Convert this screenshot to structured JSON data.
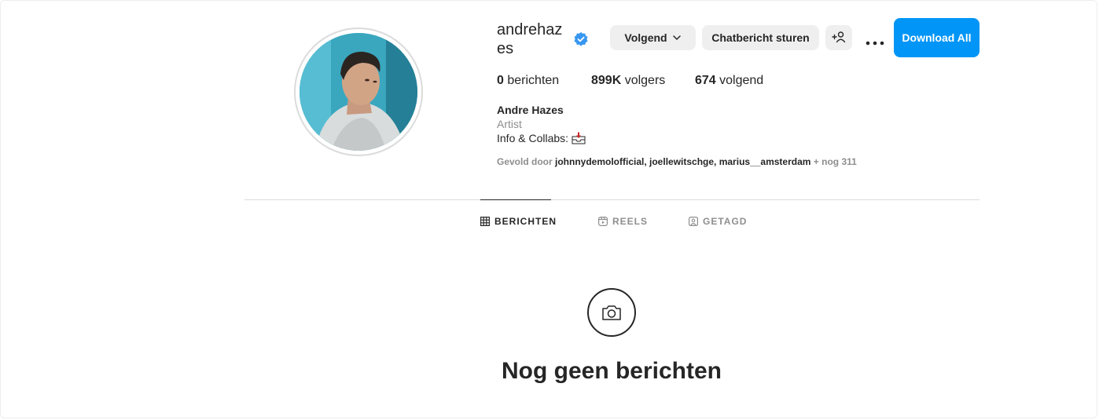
{
  "profile": {
    "username": "andrehazes",
    "verified_icon": "verified-badge-icon",
    "display_name": "Andre Hazes",
    "category": "Artist",
    "bio_line": "Info & Collabs:",
    "bio_emoji_icon": "inbox-tray-icon"
  },
  "actions": {
    "follow_label": "Volgend",
    "message_label": "Chatbericht sturen",
    "add_user_icon": "add-person-icon",
    "more_icon": "more-options-icon",
    "download_label": "Download All",
    "download_color": "#0095f6"
  },
  "stats": {
    "posts_count": "0",
    "posts_label": "berichten",
    "followers_count": "899K",
    "followers_label": "volgers",
    "following_count": "674",
    "following_label": "volgend"
  },
  "followed_by": {
    "prefix": "Gevold door",
    "names": "johnnydemolofficial, joellewitschge, marius__amsterdam",
    "suffix": "+ nog 311"
  },
  "tabs": [
    {
      "label": "BERICHTEN",
      "icon": "grid-icon",
      "active": true
    },
    {
      "label": "REELS",
      "icon": "reels-icon",
      "active": false
    },
    {
      "label": "GETAGD",
      "icon": "tagged-icon",
      "active": false
    }
  ],
  "empty_state": {
    "icon": "camera-icon",
    "title": "Nog geen berichten"
  },
  "colors": {
    "text": "#262626",
    "muted": "#8e8e8e",
    "button_gray": "#efefef",
    "border": "#dbdbdb"
  }
}
